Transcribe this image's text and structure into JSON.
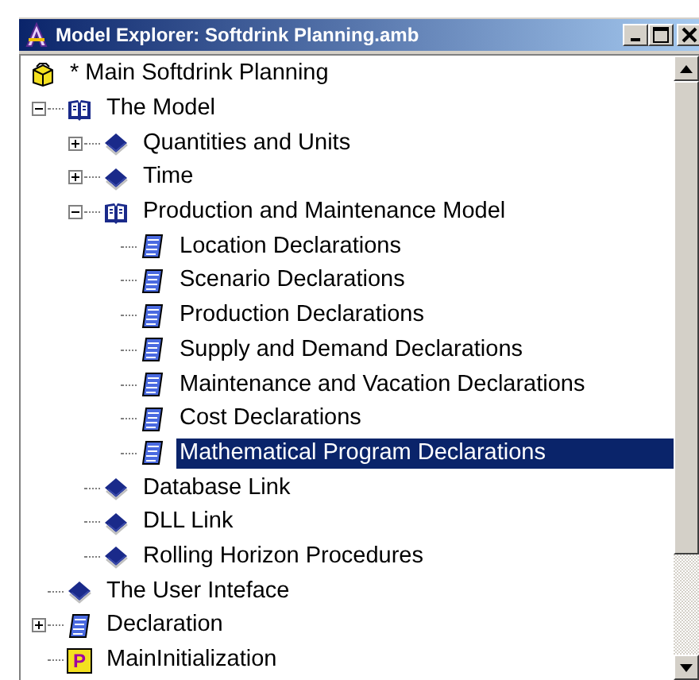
{
  "window": {
    "title": "Model Explorer: Softdrink Planning.amb"
  },
  "tree": [
    {
      "label": "* Main Softdrink Planning",
      "kind": "box",
      "selected": false,
      "children": [
        {
          "label": "The Model",
          "kind": "open-book",
          "selected": false,
          "expanded": true,
          "children": [
            {
              "label": "Quantities and Units",
              "kind": "book",
              "selected": false,
              "expanded": false
            },
            {
              "label": "Time",
              "kind": "book",
              "selected": false,
              "expanded": false
            },
            {
              "label": "Production and Maintenance Model",
              "kind": "open-book",
              "selected": false,
              "expanded": true,
              "children": [
                {
                  "label": "Location Declarations",
                  "kind": "scroll",
                  "selected": false
                },
                {
                  "label": "Scenario Declarations",
                  "kind": "scroll",
                  "selected": false
                },
                {
                  "label": "Production Declarations",
                  "kind": "scroll",
                  "selected": false
                },
                {
                  "label": "Supply and Demand Declarations",
                  "kind": "scroll",
                  "selected": false
                },
                {
                  "label": "Maintenance and Vacation Declarations",
                  "kind": "scroll",
                  "selected": false
                },
                {
                  "label": "Cost Declarations",
                  "kind": "scroll",
                  "selected": false
                },
                {
                  "label": "Mathematical Program Declarations",
                  "kind": "scroll",
                  "selected": true
                }
              ]
            },
            {
              "label": "Database Link",
              "kind": "book",
              "selected": false
            },
            {
              "label": "DLL Link",
              "kind": "book",
              "selected": false
            },
            {
              "label": "Rolling Horizon Procedures",
              "kind": "book",
              "selected": false
            }
          ]
        },
        {
          "label": "The User Inteface",
          "kind": "book",
          "selected": false
        },
        {
          "label": "Declaration",
          "kind": "scroll",
          "selected": false,
          "expanded": false
        },
        {
          "label": "MainInitialization",
          "kind": "procedure",
          "badge": "P",
          "selected": false
        }
      ]
    }
  ]
}
